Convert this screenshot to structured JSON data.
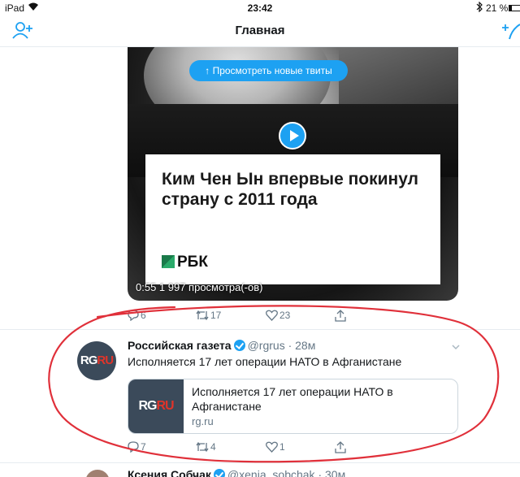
{
  "status_bar": {
    "carrier": "iPad",
    "time": "23:42",
    "battery": "21 %"
  },
  "nav": {
    "title": "Главная",
    "left_icon": "add-user-icon",
    "right_icon": "compose-tweet-icon"
  },
  "new_tweets_pill": "↑  Просмотреть новые твиты",
  "video_tweet": {
    "headline": "Ким Чен Ын впервые покинул страну с 2011 года",
    "source_logo": "РБК",
    "stats": "0:55  1 997 просмотра(-ов)",
    "replies": "6",
    "retweets": "17",
    "likes": "23"
  },
  "tweet": {
    "avatar_text_a": "RG",
    "avatar_text_b": "RU",
    "name": "Российская газета",
    "handle": "@rgrus · 28м",
    "text": "Исполняется 17 лет операции НАТО в Афганистане",
    "link_title": "Исполняется 17 лет операции НАТО в Афганистане",
    "link_domain": "rg.ru",
    "replies": "7",
    "retweets": "4",
    "likes": "1"
  },
  "next_tweet": {
    "name": "Ксения Собчак",
    "handle": "@xenia_sobchak · 30м"
  },
  "colors": {
    "accent": "#1da1f2",
    "annotation": "#e0303a",
    "muted": "#657786"
  }
}
